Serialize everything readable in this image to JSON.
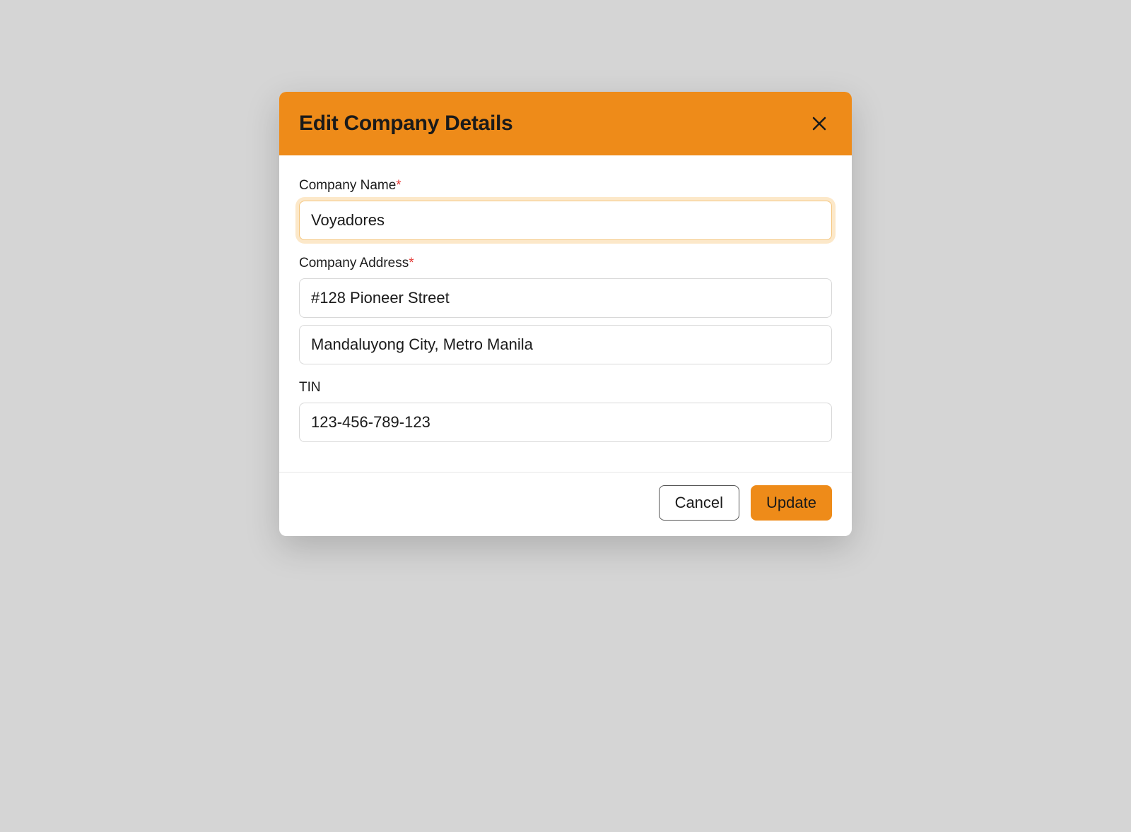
{
  "modal": {
    "title": "Edit Company Details",
    "fields": {
      "company_name": {
        "label": "Company Name",
        "value": "Voyadores"
      },
      "company_address": {
        "label": "Company Address",
        "line1": "#128 Pioneer Street",
        "line2": "Mandaluyong City, Metro Manila"
      },
      "tin": {
        "label": "TIN",
        "value": "123-456-789-123"
      }
    },
    "footer": {
      "cancel_label": "Cancel",
      "update_label": "Update"
    }
  },
  "required_marker": "*"
}
